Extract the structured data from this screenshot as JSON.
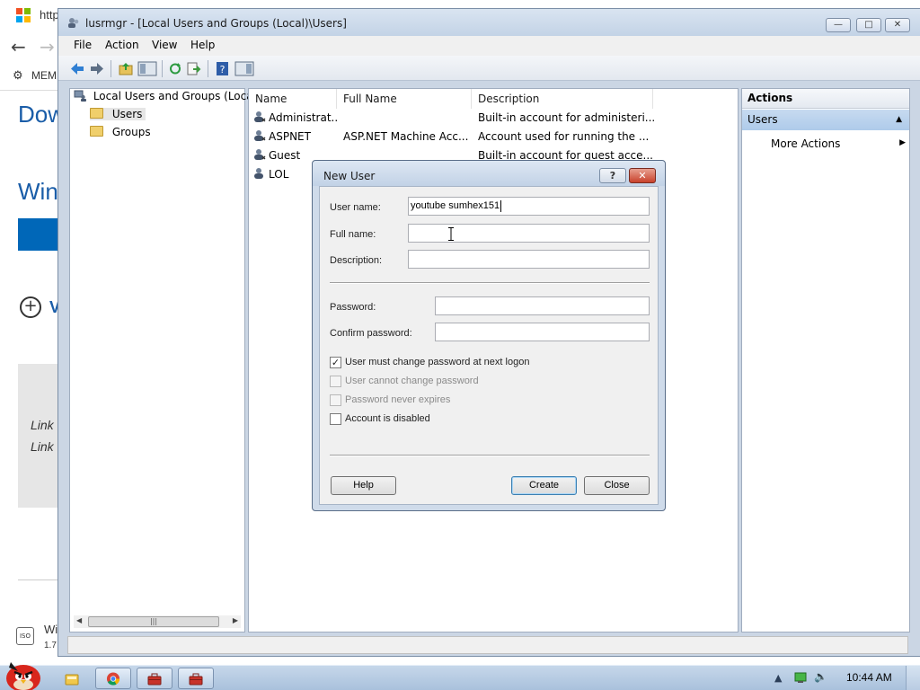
{
  "browser": {
    "tab_text": "http",
    "mem_text": "MEM",
    "heading1": "Dow",
    "heading2": "Win",
    "v_text": "V",
    "link1": "Link",
    "link2": "Link",
    "footer_title": "Wi",
    "footer_sub": "1.7",
    "footer_icon": "ISO",
    "colors": {
      "accent": "#0067b8",
      "heading": "#1a5da8"
    }
  },
  "window": {
    "title": "lusrmgr - [Local Users and Groups (Local)\\Users]",
    "controls": {
      "minimize": "—",
      "maximize": "□",
      "close": "✕"
    },
    "menu": [
      "File",
      "Action",
      "View",
      "Help"
    ],
    "toolbar_icons": [
      "back-icon",
      "forward-icon",
      "up-folder-icon",
      "show-hide-tree-icon",
      "refresh-icon",
      "export-list-icon",
      "help-icon",
      "show-hide-action-pane-icon"
    ]
  },
  "tree": {
    "root": "Local Users and Groups (Loca",
    "items": [
      "Users",
      "Groups"
    ],
    "selected": "Users",
    "scroll_grip": "|||"
  },
  "list": {
    "columns": [
      "Name",
      "Full Name",
      "Description"
    ],
    "rows": [
      {
        "name": "Administrat...",
        "full_name": "",
        "description": "Built-in account for administeri..."
      },
      {
        "name": "ASPNET",
        "full_name": "ASP.NET Machine Acc...",
        "description": "Account used for running the ..."
      },
      {
        "name": "Guest",
        "full_name": "",
        "description": "Built-in account for guest acce..."
      },
      {
        "name": "LOL",
        "full_name": "",
        "description": ""
      }
    ]
  },
  "actions": {
    "header": "Actions",
    "group": "Users",
    "items": [
      "More Actions"
    ]
  },
  "dialog": {
    "title": "New User",
    "help_glyph": "?",
    "close_glyph": "✕",
    "fields": {
      "user_name": {
        "label": "User name:",
        "value": "youtube sumhex151"
      },
      "full_name": {
        "label": "Full name:",
        "value": ""
      },
      "description": {
        "label": "Description:",
        "value": ""
      },
      "password": {
        "label": "Password:",
        "value": ""
      },
      "confirm_password": {
        "label": "Confirm password:",
        "value": ""
      }
    },
    "checkboxes": [
      {
        "label": "User must change password at next logon",
        "checked": true,
        "enabled": true
      },
      {
        "label": "User cannot change password",
        "checked": false,
        "enabled": false
      },
      {
        "label": "Password never expires",
        "checked": false,
        "enabled": false
      },
      {
        "label": "Account is disabled",
        "checked": false,
        "enabled": true
      }
    ],
    "check_glyph": "✓",
    "buttons": {
      "help": "Help",
      "create": "Create",
      "close": "Close"
    }
  },
  "taskbar": {
    "time": "10:44 AM",
    "tray_icons": [
      "show-hidden-icons-icon",
      "network-icon",
      "volume-icon"
    ],
    "tray_glyphs": {
      "arrow": "▲",
      "volume": "🔈"
    },
    "apps": [
      "explorer-icon",
      "chrome-icon",
      "toolbox-icon",
      "toolbox-icon"
    ]
  }
}
